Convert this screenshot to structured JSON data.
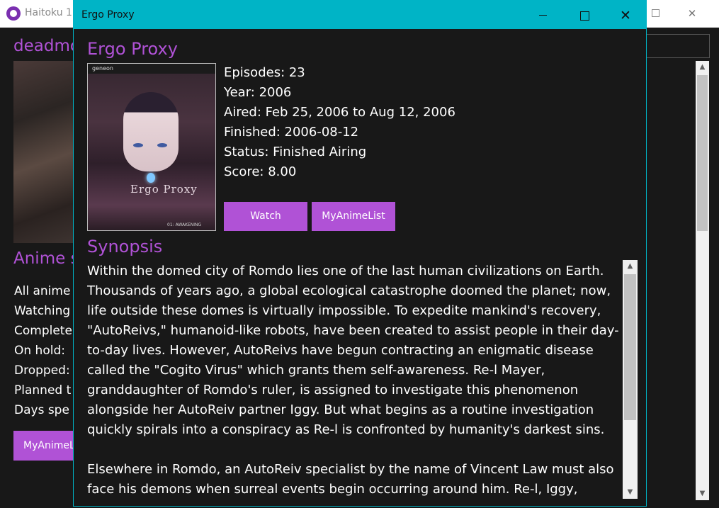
{
  "back_window": {
    "title": "Haitoku 1.",
    "username": "deadmo",
    "section_heading": "Anime s",
    "stats": [
      "All anime",
      "Watching",
      "Complete",
      "On hold:",
      "Dropped:",
      "Planned t",
      "Days spe"
    ],
    "mal_button": "MyAnimeL",
    "close_glyph": "✕"
  },
  "dialog": {
    "window_title": "Ergo Proxy",
    "close_glyph": "✕",
    "anime_title": "Ergo Proxy",
    "cover": {
      "publisher": "geneon",
      "logo_text": "Ergo Proxy",
      "sub_text": "01: AWAKENING"
    },
    "info": {
      "episodes": "Episodes: 23",
      "year": "Year: 2006",
      "aired": "Aired: Feb 25, 2006 to Aug 12, 2006",
      "finished": "Finished: 2006-08-12",
      "status": "Status: Finished Airing",
      "score": "Score: 8.00"
    },
    "buttons": {
      "watch": "Watch",
      "myanimelist": "MyAnimeList"
    },
    "synopsis_heading": "Synopsis",
    "synopsis": "Within the domed city of Romdo lies one of the last human civilizations on Earth. Thousands of years ago, a global ecological catastrophe doomed the planet; now, life outside these domes is virtually impossible. To expedite mankind's recovery, \"AutoReivs,\" humanoid-like robots, have been created to assist people in their day-to-day lives. However, AutoReivs have begun contracting an enigmatic disease called the \"Cogito Virus\" which grants them self-awareness. Re-l Mayer, granddaughter of Romdo's ruler, is assigned to investigate this phenomenon alongside her AutoReiv partner Iggy. But what begins as a routine investigation quickly spirals into a conspiracy as Re-l is confronted by humanity's darkest sins.\n\nElsewhere in Romdo, an AutoReiv specialist by the name of Vincent Law must also face his demons when surreal events begin occurring around him. Re-l, Iggy,"
  },
  "colors": {
    "accent": "#b052d6",
    "dialog_titlebar": "#00b4c6",
    "background": "#181818",
    "text": "#ffffff"
  },
  "icons": {
    "scroll_up": "▲",
    "scroll_down": "▼"
  }
}
